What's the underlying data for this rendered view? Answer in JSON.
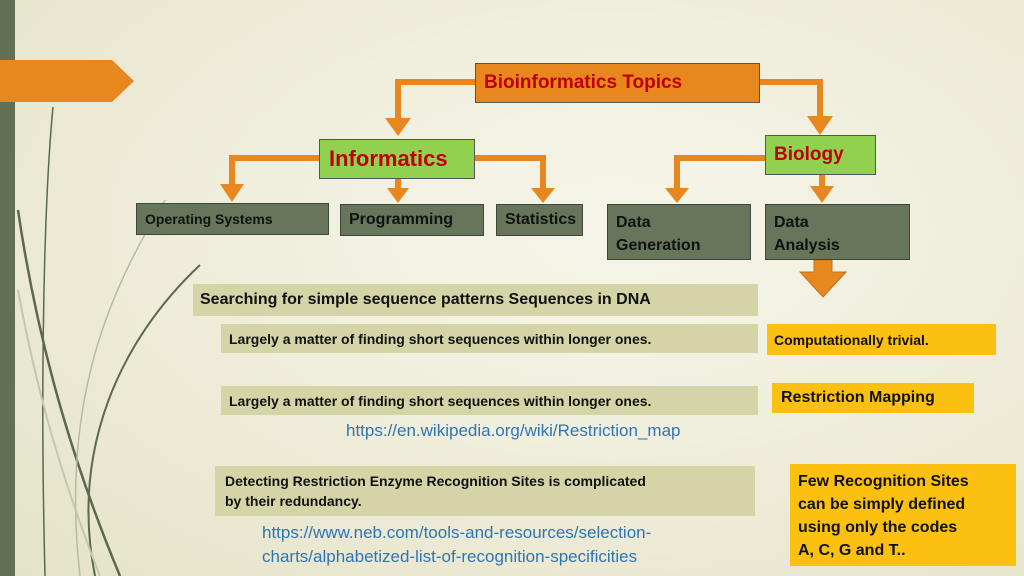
{
  "diagram": {
    "root": "Bioinformatics Topics",
    "informatics": {
      "label": "Informatics",
      "children": [
        "Operating Systems",
        "Programming",
        "Statistics"
      ]
    },
    "biology": {
      "label": "Biology",
      "children": [
        {
          "line1": "Data",
          "line2": "Generation"
        },
        {
          "line1": "Data",
          "line2": "Analysis"
        }
      ]
    }
  },
  "content": {
    "search_heading": "Searching for simple sequence patterns Sequences in DNA",
    "point1": "Largely a matter of finding short sequences within longer ones.",
    "point1_note": "Computationally trivial.",
    "point2": "Largely a matter of finding short sequences within longer ones.",
    "point2_note": "Restriction Mapping",
    "link1": "https://en.wikipedia.org/wiki/Restriction_map",
    "detecting_line1": "Detecting Restriction Enzyme Recognition Sites is complicated",
    "detecting_line2": "by their redundancy.",
    "link2_line1": "https://www.neb.com/tools-and-resources/selection-",
    "link2_line2": "charts/alphabetized-list-of-recognition-specificities",
    "few_sites": [
      "Few Recognition Sites",
      "can be simply defined",
      "using only the codes",
      "A, C, G and T.."
    ]
  },
  "colors": {
    "orange": "#e8871e",
    "green": "#92d050",
    "dark_olive": "#67765a",
    "light_olive": "#d5d4a7",
    "yellow": "#fcc010",
    "red_text": "#c00000",
    "link_blue": "#2e75b6"
  }
}
